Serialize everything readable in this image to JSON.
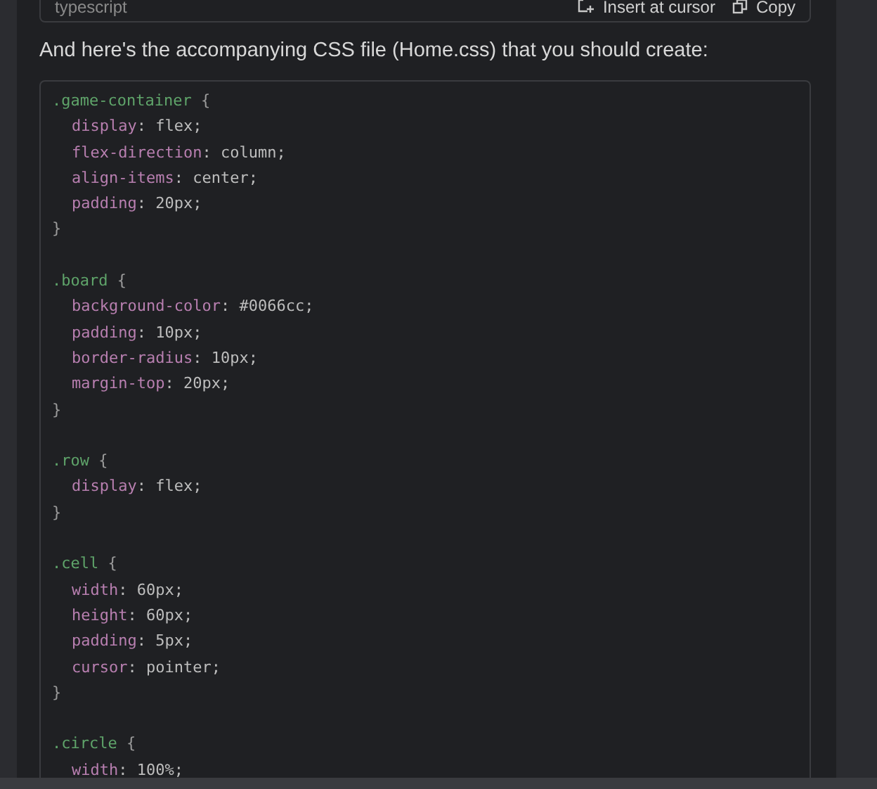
{
  "previous_code_block": {
    "language": "typescript",
    "actions": [
      {
        "kind": "insert",
        "label": "Insert at cursor"
      },
      {
        "kind": "copy",
        "label": "Copy"
      }
    ]
  },
  "message": "And here's the accompanying CSS file (Home.css) that you should create:",
  "code_lines": [
    {
      "kind": "selector",
      "selector": ".game-container",
      "brace": "{"
    },
    {
      "kind": "declaration",
      "property": "display",
      "separator": ":",
      "value": "flex;"
    },
    {
      "kind": "declaration",
      "property": "flex-direction",
      "separator": ":",
      "value": "column;"
    },
    {
      "kind": "declaration",
      "property": "align-items",
      "separator": ":",
      "value": "center;"
    },
    {
      "kind": "declaration",
      "property": "padding",
      "separator": ":",
      "value": "20px;"
    },
    {
      "kind": "close",
      "brace": "}"
    },
    {
      "kind": "blank"
    },
    {
      "kind": "selector",
      "selector": ".board",
      "brace": "{"
    },
    {
      "kind": "declaration",
      "property": "background-color",
      "separator": ":",
      "value": "#0066cc;"
    },
    {
      "kind": "declaration",
      "property": "padding",
      "separator": ":",
      "value": "10px;"
    },
    {
      "kind": "declaration",
      "property": "border-radius",
      "separator": ":",
      "value": "10px;"
    },
    {
      "kind": "declaration",
      "property": "margin-top",
      "separator": ":",
      "value": "20px;"
    },
    {
      "kind": "close",
      "brace": "}"
    },
    {
      "kind": "blank"
    },
    {
      "kind": "selector",
      "selector": ".row",
      "brace": "{"
    },
    {
      "kind": "declaration",
      "property": "display",
      "separator": ":",
      "value": "flex;"
    },
    {
      "kind": "close",
      "brace": "}"
    },
    {
      "kind": "blank"
    },
    {
      "kind": "selector",
      "selector": ".cell",
      "brace": "{"
    },
    {
      "kind": "declaration",
      "property": "width",
      "separator": ":",
      "value": "60px;"
    },
    {
      "kind": "declaration",
      "property": "height",
      "separator": ":",
      "value": "60px;"
    },
    {
      "kind": "declaration",
      "property": "padding",
      "separator": ":",
      "value": "5px;"
    },
    {
      "kind": "declaration",
      "property": "cursor",
      "separator": ":",
      "value": "pointer;"
    },
    {
      "kind": "close",
      "brace": "}"
    },
    {
      "kind": "blank"
    },
    {
      "kind": "selector",
      "selector": ".circle",
      "brace": "{"
    },
    {
      "kind": "declaration",
      "property": "width",
      "separator": ":",
      "value": "100%;"
    }
  ]
}
